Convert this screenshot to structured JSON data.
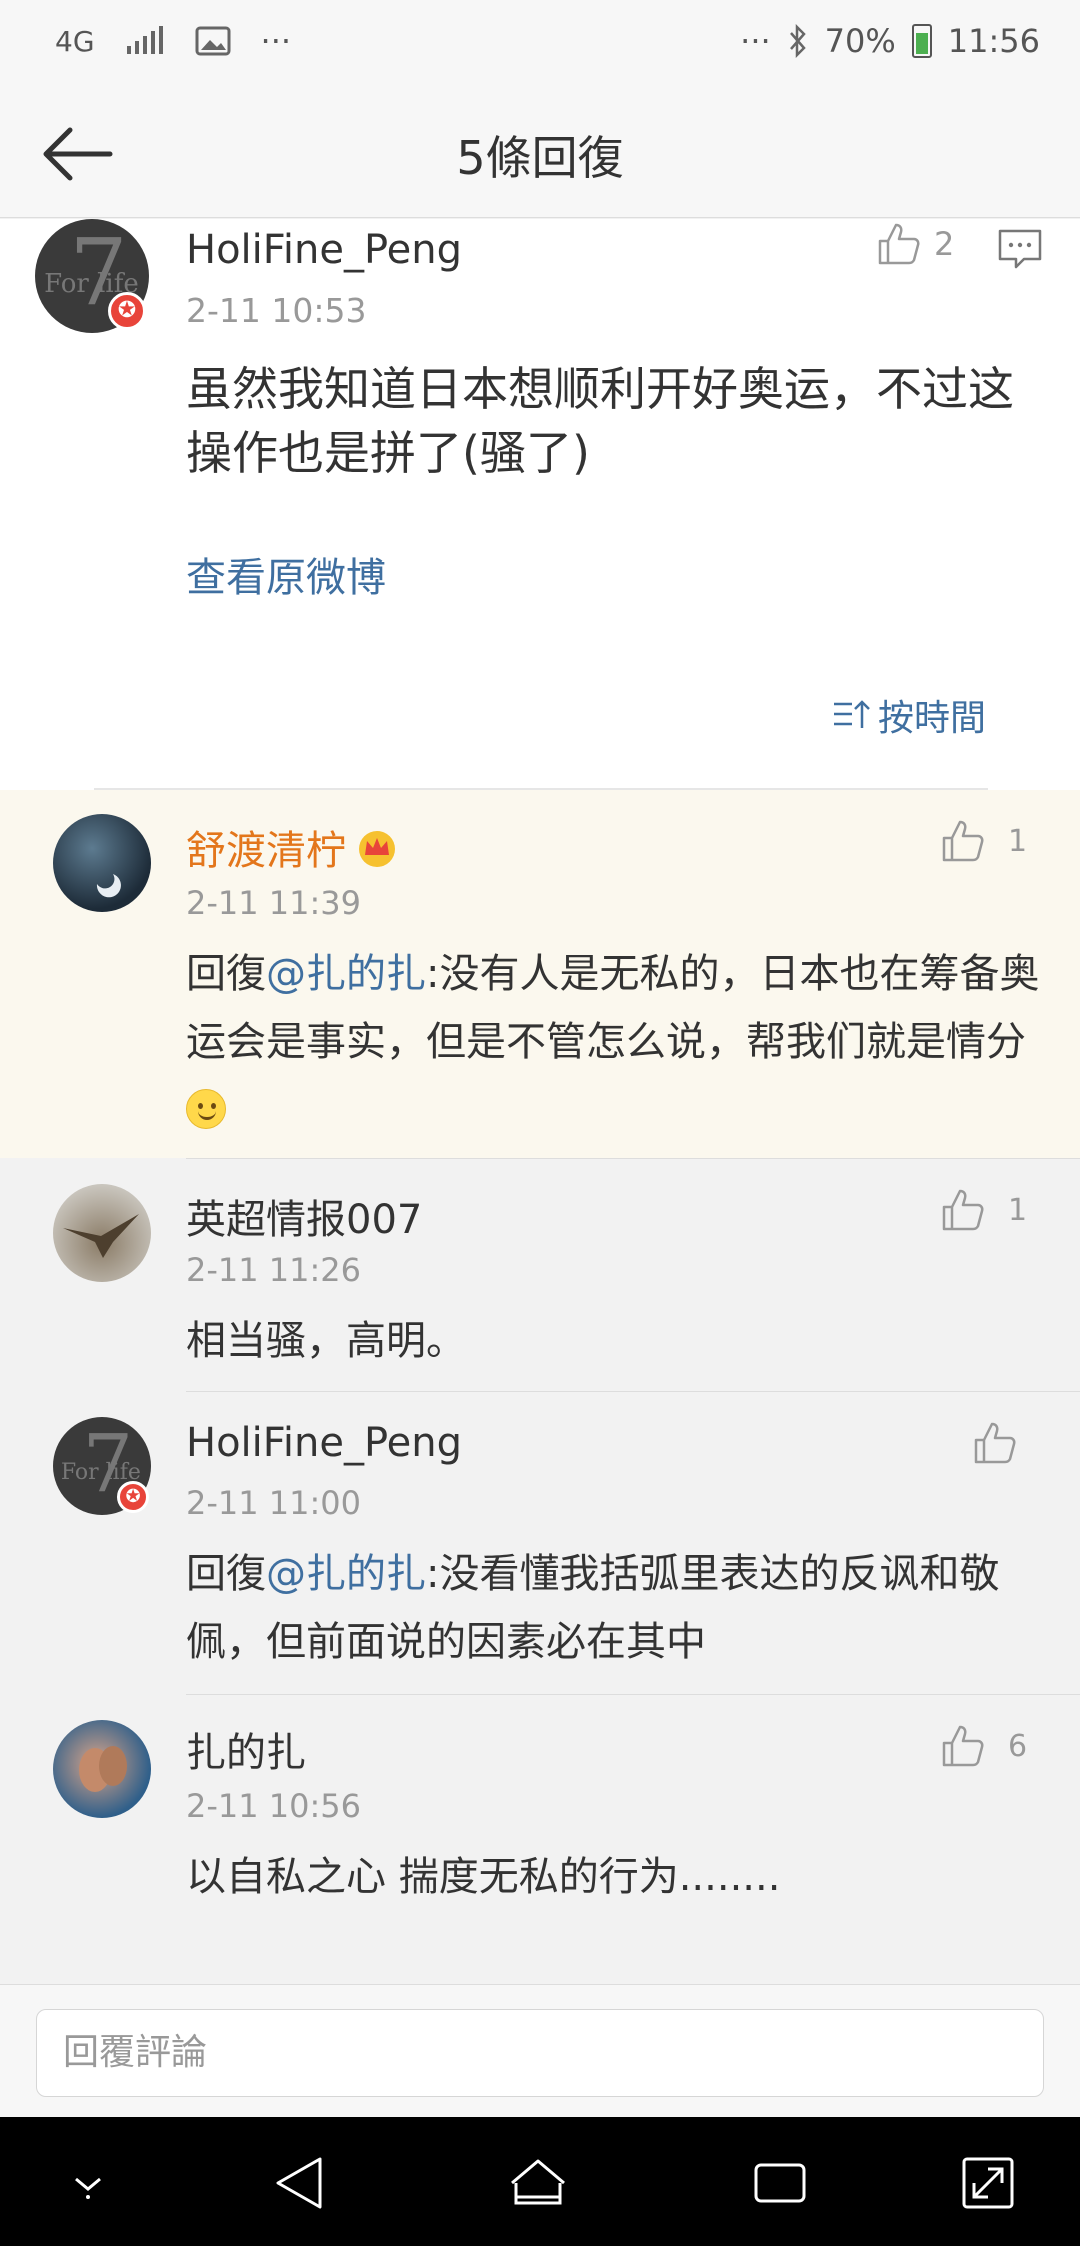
{
  "status_bar": {
    "network": "4G",
    "battery": "70%",
    "time": "11:56",
    "icons": [
      "network-4g-icon",
      "signal-icon",
      "image-icon",
      "more-icon",
      "bluetooth-icon",
      "battery-icon"
    ]
  },
  "header": {
    "title": "5條回復",
    "back_icon": "arrow-left-icon"
  },
  "main_comment": {
    "author": "HoliFine_Peng",
    "avatar_text": {
      "seven": "7",
      "for_life": "For life"
    },
    "time": "2-11 10:53",
    "likes": "2",
    "text": "虽然我知道日本想顺利开好奥运，不过这操作也是拼了(骚了)",
    "view_original": "查看原微博",
    "sort_label": "按時間"
  },
  "replies": [
    {
      "author": "舒渡清柠",
      "time": "2-11 11:39",
      "likes": "1",
      "prefix": "回復",
      "mention": "@扎的扎",
      "text": ":没有人是无私的，日本也在筹备奥运会是事实，但是不管怎么说，帮我们就是情分"
    },
    {
      "author": "英超情报007",
      "time": "2-11 11:26",
      "likes": "1",
      "text": "相当骚，高明。"
    },
    {
      "author": "HoliFine_Peng",
      "time": "2-11 11:00",
      "likes": "",
      "prefix": "回復",
      "mention": "@扎的扎",
      "text": ":没看懂我括弧里表达的反讽和敬佩，但前面说的因素必在其中"
    },
    {
      "author": "扎的扎",
      "time": "2-11 10:56",
      "likes": "6",
      "text": "以自私之心 揣度无私的行为........"
    }
  ],
  "input": {
    "placeholder": "回覆評論"
  },
  "colors": {
    "link": "#3f6fa0",
    "vip_name": "#e3761b",
    "highlight_bg": "#fbf8ee"
  }
}
